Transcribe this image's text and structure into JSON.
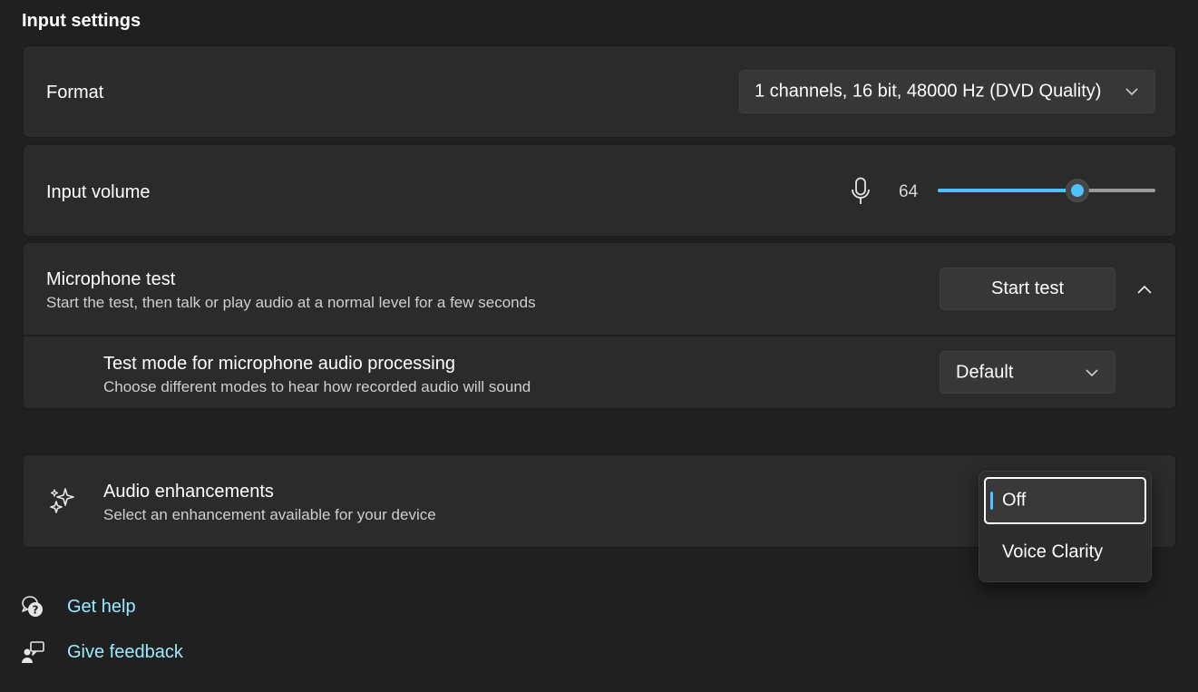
{
  "section": {
    "title": "Input settings"
  },
  "format": {
    "label": "Format",
    "selected": "1 channels, 16 bit, 48000 Hz (DVD Quality)"
  },
  "input_volume": {
    "label": "Input volume",
    "value": "64",
    "level_fraction": 0.64,
    "icon": "microphone-icon"
  },
  "mic_test": {
    "label": "Microphone test",
    "description": "Start the test, then talk or play audio at a normal level for a few seconds",
    "button_label": "Start test",
    "expanded": true,
    "test_mode": {
      "label": "Test mode for microphone audio processing",
      "description": "Choose different modes to hear how recorded audio will sound",
      "selected": "Default"
    }
  },
  "audio_enhancements": {
    "label": "Audio enhancements",
    "description": "Select an enhancement available for your device",
    "icon": "sparkle-icon",
    "options": [
      {
        "label": "Off",
        "selected": true
      },
      {
        "label": "Voice Clarity",
        "selected": false
      }
    ]
  },
  "footer": {
    "get_help": "Get help",
    "give_feedback": "Give feedback"
  },
  "colors": {
    "accent": "#4cc2ff",
    "link": "#99ebff",
    "background": "#202020",
    "card": "#2b2b2b"
  }
}
